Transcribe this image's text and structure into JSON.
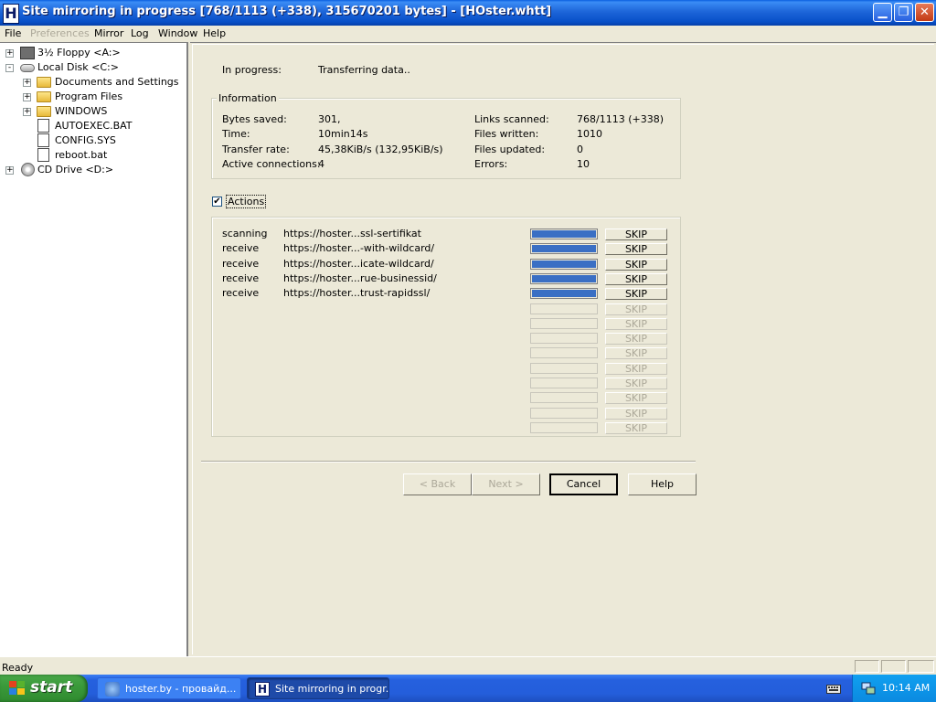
{
  "window": {
    "title": "Site mirroring in progress [768/1113 (+338), 315670201 bytes] - [HOster.whtt]",
    "app_icon_letter": "H",
    "controls": [
      "minimize",
      "restore",
      "close"
    ]
  },
  "menu": {
    "items": [
      {
        "label": "File",
        "enabled": true
      },
      {
        "label": "Preferences",
        "enabled": false
      },
      {
        "label": "Mirror",
        "enabled": true
      },
      {
        "label": "Log",
        "enabled": true
      },
      {
        "label": "Window",
        "enabled": true
      },
      {
        "label": "Help",
        "enabled": true
      }
    ]
  },
  "tree": {
    "items": [
      {
        "label": "3½ Floppy <A:>",
        "icon": "floppy-icon",
        "expander": "+"
      },
      {
        "label": "Local Disk <C:>",
        "icon": "drive-icon",
        "expander": "-"
      },
      {
        "label": "Documents and Settings",
        "icon": "folder-icon",
        "expander": "+"
      },
      {
        "label": "Program Files",
        "icon": "folder-icon",
        "expander": "+"
      },
      {
        "label": "WINDOWS",
        "icon": "folder-icon",
        "expander": "+"
      },
      {
        "label": "AUTOEXEC.BAT",
        "icon": "file-icon",
        "expander": ""
      },
      {
        "label": "CONFIG.SYS",
        "icon": "file-icon",
        "expander": ""
      },
      {
        "label": "reboot.bat",
        "icon": "file-icon",
        "expander": ""
      },
      {
        "label": "CD Drive <D:>",
        "icon": "cd-icon",
        "expander": "+"
      }
    ]
  },
  "progress": {
    "label": "In progress:",
    "value": "Transferring data.."
  },
  "information": {
    "title": "Information",
    "left": [
      {
        "label": "Bytes saved:",
        "value": "301,"
      },
      {
        "label": "Time:",
        "value": "10min14s"
      },
      {
        "label": "Transfer rate:",
        "value": "45,38KiB/s (132,95KiB/s)"
      },
      {
        "label": "Active connections:",
        "value": "4"
      }
    ],
    "right": [
      {
        "label": "Links scanned:",
        "value": "768/1113 (+338)"
      },
      {
        "label": "Files written:",
        "value": "1010"
      },
      {
        "label": "Files updated:",
        "value": "0"
      },
      {
        "label": "Errors:",
        "value": "10"
      }
    ]
  },
  "actions": {
    "label": "Actions",
    "checked": true,
    "rows": [
      {
        "action": "scanning",
        "url": "https://hoster...ssl-sertifikat",
        "progress": 1.0,
        "skip": "SKIP",
        "enabled": true
      },
      {
        "action": "receive",
        "url": "https://hoster...-with-wildcard/",
        "progress": 1.0,
        "skip": "SKIP",
        "enabled": true
      },
      {
        "action": "receive",
        "url": "https://hoster...icate-wildcard/",
        "progress": 1.0,
        "skip": "SKIP",
        "enabled": true
      },
      {
        "action": "receive",
        "url": "https://hoster...rue-businessid/",
        "progress": 1.0,
        "skip": "SKIP",
        "enabled": true
      },
      {
        "action": "receive",
        "url": "https://hoster...trust-rapidssl/",
        "progress": 1.0,
        "skip": "SKIP",
        "enabled": true
      },
      {
        "action": "",
        "url": "",
        "progress": 0,
        "skip": "SKIP",
        "enabled": false
      },
      {
        "action": "",
        "url": "",
        "progress": 0,
        "skip": "SKIP",
        "enabled": false
      },
      {
        "action": "",
        "url": "",
        "progress": 0,
        "skip": "SKIP",
        "enabled": false
      },
      {
        "action": "",
        "url": "",
        "progress": 0,
        "skip": "SKIP",
        "enabled": false
      },
      {
        "action": "",
        "url": "",
        "progress": 0,
        "skip": "SKIP",
        "enabled": false
      },
      {
        "action": "",
        "url": "",
        "progress": 0,
        "skip": "SKIP",
        "enabled": false
      },
      {
        "action": "",
        "url": "",
        "progress": 0,
        "skip": "SKIP",
        "enabled": false
      },
      {
        "action": "",
        "url": "",
        "progress": 0,
        "skip": "SKIP",
        "enabled": false
      },
      {
        "action": "",
        "url": "",
        "progress": 0,
        "skip": "SKIP",
        "enabled": false
      }
    ]
  },
  "buttons": {
    "back": "< Back",
    "next": "Next >",
    "cancel": "Cancel",
    "help": "Help"
  },
  "status": {
    "text": "Ready"
  },
  "taskbar": {
    "start_label": "start",
    "tasks": [
      {
        "label": "hoster.by - провайд...",
        "active": false
      },
      {
        "label": "Site mirroring in progr...",
        "active": true
      }
    ],
    "clock": "10:14 AM"
  },
  "colors": {
    "progress_fill": "#3a6fc4",
    "titlebar": "#0a5fe0",
    "taskbar": "#245edb",
    "start": "#3b9a3b"
  }
}
